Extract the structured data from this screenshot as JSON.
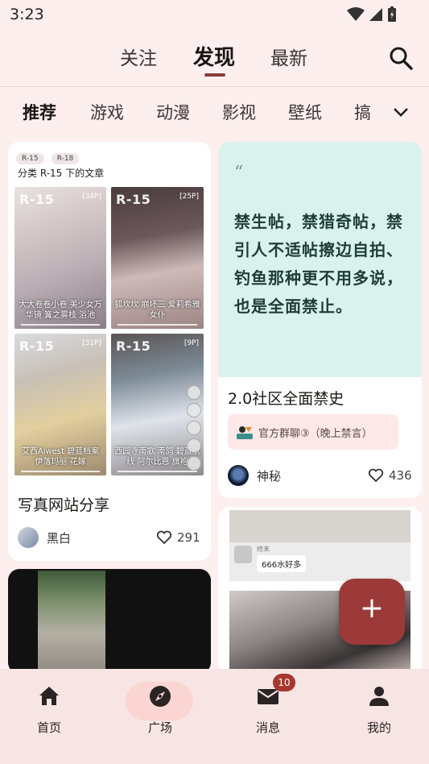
{
  "status_bar": {
    "time": "3:23"
  },
  "top_tabs": [
    "关注",
    "发现",
    "最新"
  ],
  "categories": [
    "推荐",
    "游戏",
    "动漫",
    "影视",
    "壁纸",
    "搞"
  ],
  "card1": {
    "tags": [
      "R-15",
      "R-18"
    ],
    "heading": "分类 R-15 下的文章",
    "thumbs": [
      {
        "label": "R-15",
        "count": "[34P]",
        "caption": "大大卷卷小卷 美少女万华镜 篝之雾枝 浴池"
      },
      {
        "label": "R-15",
        "count": "[25P]",
        "caption": "狐坎坎 崩坏三 爱莉希雅 女仆"
      },
      {
        "label": "R-15",
        "count": "[31P]",
        "caption": "艾西Aiwest 碧蓝档案 伊落玛丽 花嫁"
      },
      {
        "label": "R-15",
        "count": "[9P]",
        "caption": "西园寺南歌 南鸽 碧蓝航线 阿尔比恩 旗袍"
      }
    ],
    "title": "写真网站分享",
    "author": "黑白",
    "likes": "291"
  },
  "card2": {
    "quote": "禁生帖，禁猎奇帖，禁引人不适帖擦边自拍、钓鱼那种更不用多说，也是全面禁止。",
    "title": "2.0社区全面禁史",
    "group": "官方群聊③（晚上禁言）",
    "author": "神秘",
    "likes": "436"
  },
  "card4": {
    "chat_name": "终末",
    "chat_msg": "666水好多"
  },
  "bottom_nav": [
    {
      "label": "首页",
      "icon": "home-icon"
    },
    {
      "label": "广场",
      "icon": "compass-icon"
    },
    {
      "label": "消息",
      "icon": "mail-icon",
      "badge": "10"
    },
    {
      "label": "我的",
      "icon": "person-icon"
    }
  ],
  "colors": {
    "accent": "#9c3a3a",
    "background": "#fcefee",
    "quote_bg": "#daf2ed"
  }
}
